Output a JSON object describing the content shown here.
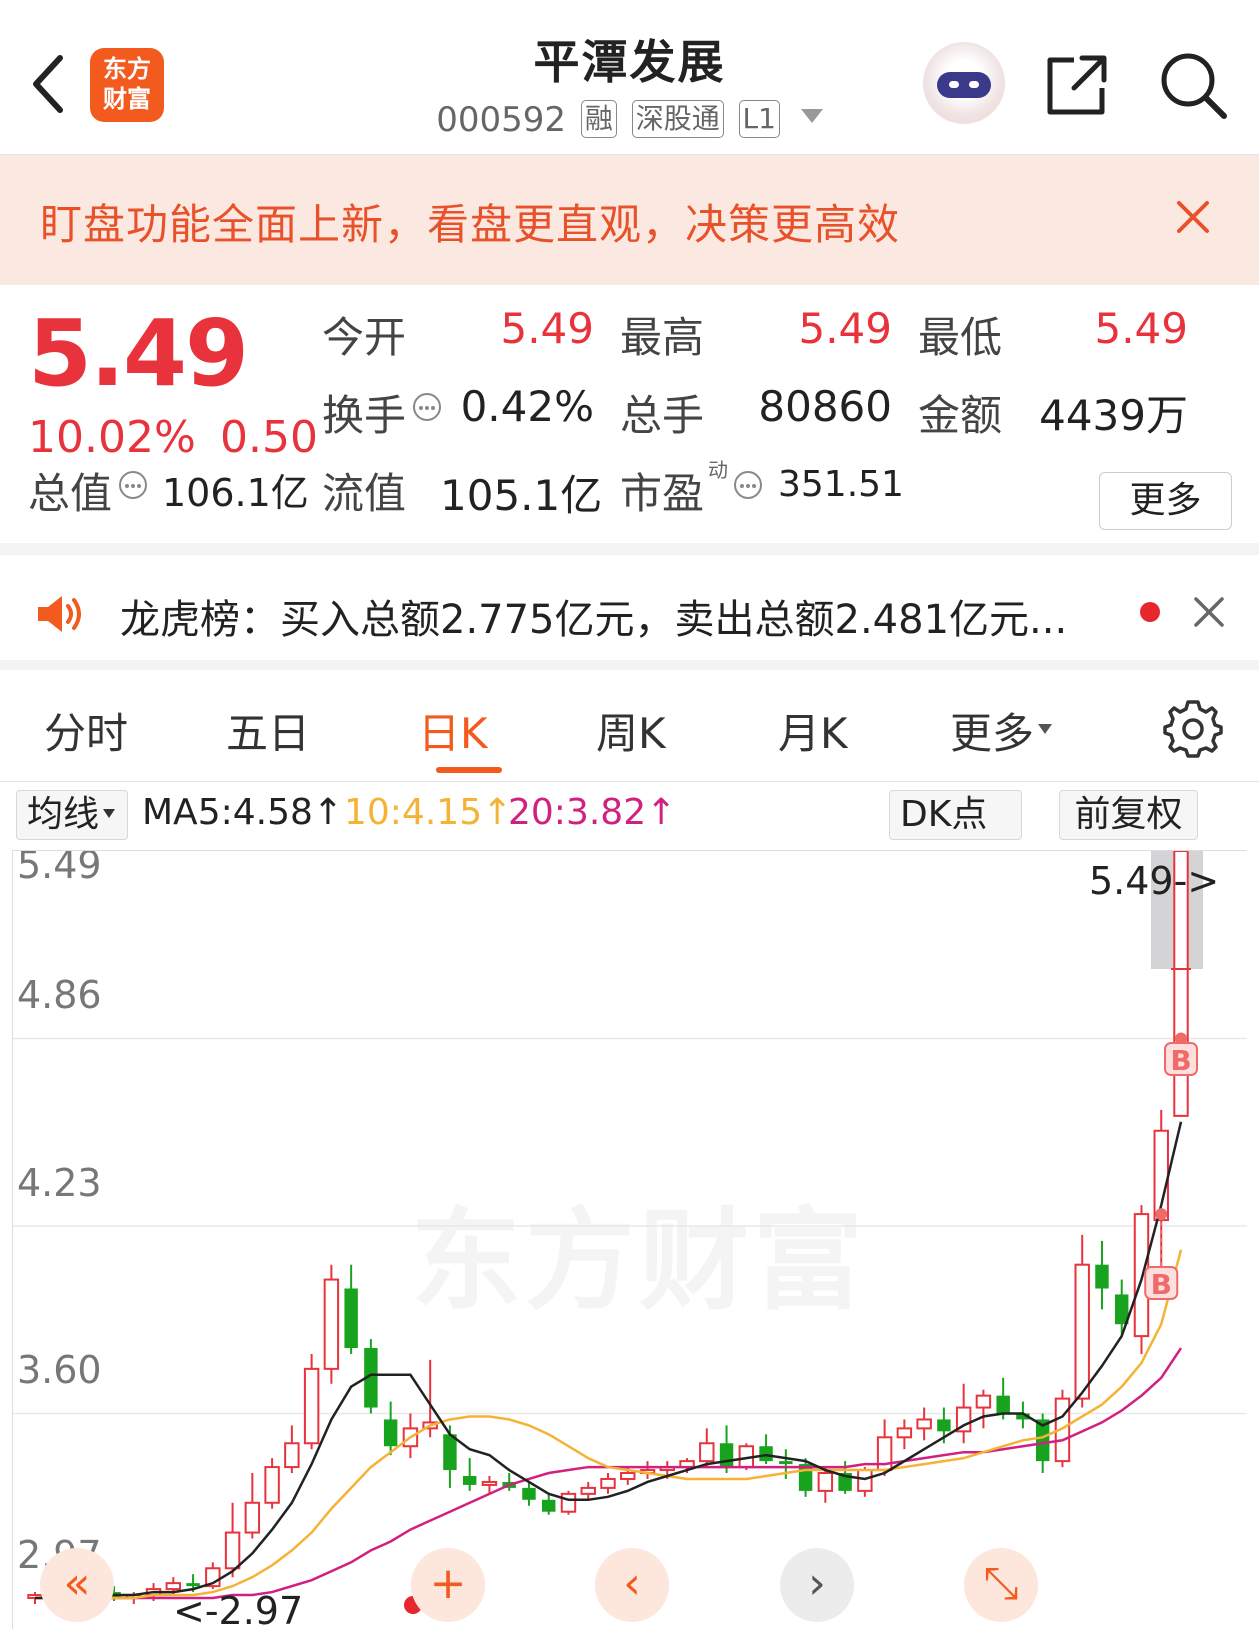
{
  "header": {
    "title": "平潭发展",
    "code": "000592",
    "tags": [
      "融",
      "深股通",
      "L1"
    ],
    "logo_lines": [
      "东方",
      "财富"
    ]
  },
  "banner": {
    "text": "盯盘功能全面上新，看盘更直观，决策更高效"
  },
  "quote": {
    "price": "5.49",
    "change_pct": "10.02%",
    "change": "0.50",
    "open_label": "今开",
    "open": "5.49",
    "high_label": "最高",
    "high": "5.49",
    "low_label": "最低",
    "low": "5.49",
    "turnover_label": "换手",
    "turnover": "0.42%",
    "volume_label": "总手",
    "volume": "80860",
    "amount_label": "金额",
    "amount": "4439万",
    "mcap_label": "总值",
    "mcap": "106.1亿",
    "float_label": "流值",
    "float": "105.1亿",
    "pe_label": "市盈",
    "pe_sup": "动",
    "pe": "351.51",
    "more_label": "更多"
  },
  "news": {
    "text": "龙虎榜：买入总额2.775亿元，卖出总额2.481亿元..."
  },
  "tabs": {
    "items": [
      "分时",
      "五日",
      "日K",
      "周K",
      "月K",
      "更多"
    ],
    "active": "日K"
  },
  "ma_bar": {
    "indicator_label": "均线",
    "ma5": "MA5:4.58↑",
    "ma10": "10:4.15↑",
    "ma20": "20:3.82↑",
    "dk_label": "DK点",
    "adjust_label": "前复权",
    "colors": {
      "ma5": "#222222",
      "ma10": "#f5b335",
      "ma20": "#d1207f"
    }
  },
  "chart_data": {
    "type": "candlestick",
    "y_ticks": [
      "5.49",
      "4.86",
      "4.23",
      "3.60",
      "2.97"
    ],
    "ylim": [
      2.97,
      5.49
    ],
    "last_price_label": "5.49->",
    "low_label": "<-2.97",
    "watermark": "东方财富",
    "up_color": "#e8323c",
    "down_color": "#17a31e",
    "signal_label": "B",
    "candles": [
      [
        2.98,
        3.0,
        2.96,
        2.99
      ],
      [
        2.99,
        3.01,
        2.97,
        2.98
      ],
      [
        2.98,
        3.0,
        2.96,
        2.97
      ],
      [
        2.97,
        3.02,
        2.96,
        3.0
      ],
      [
        3.0,
        3.02,
        2.97,
        2.98
      ],
      [
        2.98,
        3.0,
        2.96,
        2.99
      ],
      [
        2.99,
        3.03,
        2.97,
        3.01
      ],
      [
        3.01,
        3.05,
        2.99,
        3.03
      ],
      [
        3.03,
        3.06,
        3.0,
        3.02
      ],
      [
        3.02,
        3.1,
        3.01,
        3.08
      ],
      [
        3.08,
        3.3,
        3.05,
        3.2
      ],
      [
        3.2,
        3.4,
        3.18,
        3.3
      ],
      [
        3.3,
        3.45,
        3.28,
        3.42
      ],
      [
        3.42,
        3.56,
        3.4,
        3.5
      ],
      [
        3.5,
        3.8,
        3.48,
        3.75
      ],
      [
        3.75,
        4.1,
        3.7,
        4.05
      ],
      [
        4.02,
        4.1,
        3.8,
        3.82
      ],
      [
        3.82,
        3.85,
        3.6,
        3.62
      ],
      [
        3.58,
        3.64,
        3.46,
        3.49
      ],
      [
        3.49,
        3.6,
        3.45,
        3.55
      ],
      [
        3.55,
        3.78,
        3.52,
        3.57
      ],
      [
        3.53,
        3.56,
        3.35,
        3.41
      ],
      [
        3.39,
        3.45,
        3.34,
        3.36
      ],
      [
        3.36,
        3.39,
        3.33,
        3.37
      ],
      [
        3.37,
        3.4,
        3.34,
        3.35
      ],
      [
        3.35,
        3.37,
        3.29,
        3.31
      ],
      [
        3.31,
        3.33,
        3.26,
        3.27
      ],
      [
        3.27,
        3.34,
        3.26,
        3.33
      ],
      [
        3.33,
        3.37,
        3.31,
        3.35
      ],
      [
        3.35,
        3.4,
        3.33,
        3.38
      ],
      [
        3.38,
        3.42,
        3.36,
        3.4
      ],
      [
        3.4,
        3.44,
        3.38,
        3.41
      ],
      [
        3.41,
        3.44,
        3.38,
        3.42
      ],
      [
        3.42,
        3.45,
        3.4,
        3.44
      ],
      [
        3.44,
        3.55,
        3.42,
        3.5
      ],
      [
        3.5,
        3.56,
        3.4,
        3.42
      ],
      [
        3.42,
        3.5,
        3.41,
        3.49
      ],
      [
        3.49,
        3.53,
        3.43,
        3.44
      ],
      [
        3.44,
        3.48,
        3.38,
        3.43
      ],
      [
        3.43,
        3.45,
        3.32,
        3.34
      ],
      [
        3.34,
        3.42,
        3.3,
        3.4
      ],
      [
        3.4,
        3.44,
        3.33,
        3.34
      ],
      [
        3.34,
        3.42,
        3.32,
        3.41
      ],
      [
        3.41,
        3.58,
        3.39,
        3.52
      ],
      [
        3.52,
        3.58,
        3.48,
        3.55
      ],
      [
        3.55,
        3.62,
        3.51,
        3.58
      ],
      [
        3.58,
        3.62,
        3.5,
        3.54
      ],
      [
        3.54,
        3.7,
        3.5,
        3.62
      ],
      [
        3.62,
        3.68,
        3.55,
        3.66
      ],
      [
        3.66,
        3.72,
        3.58,
        3.6
      ],
      [
        3.6,
        3.64,
        3.55,
        3.58
      ],
      [
        3.58,
        3.6,
        3.4,
        3.44
      ],
      [
        3.44,
        3.68,
        3.42,
        3.65
      ],
      [
        3.65,
        4.2,
        3.62,
        4.1
      ],
      [
        4.1,
        4.18,
        3.95,
        4.02
      ],
      [
        4.0,
        4.05,
        3.86,
        3.9
      ],
      [
        3.86,
        4.3,
        3.8,
        4.27
      ],
      [
        4.25,
        4.62,
        4.0,
        4.55
      ],
      [
        4.6,
        5.49,
        4.86,
        5.49
      ]
    ],
    "ma5": [
      2.98,
      2.98,
      2.98,
      2.99,
      2.99,
      2.99,
      3.0,
      3.0,
      3.01,
      3.03,
      3.07,
      3.13,
      3.21,
      3.3,
      3.43,
      3.58,
      3.69,
      3.73,
      3.73,
      3.73,
      3.63,
      3.53,
      3.48,
      3.46,
      3.41,
      3.37,
      3.33,
      3.31,
      3.31,
      3.32,
      3.34,
      3.37,
      3.39,
      3.41,
      3.43,
      3.44,
      3.45,
      3.46,
      3.45,
      3.44,
      3.41,
      3.39,
      3.38,
      3.4,
      3.44,
      3.48,
      3.52,
      3.56,
      3.59,
      3.6,
      3.6,
      3.56,
      3.59,
      3.67,
      3.76,
      3.86,
      4.05,
      4.3,
      4.58
    ],
    "ma10": [
      2.98,
      2.98,
      2.98,
      2.98,
      2.98,
      2.98,
      2.99,
      2.99,
      2.99,
      3.0,
      3.02,
      3.05,
      3.09,
      3.14,
      3.2,
      3.28,
      3.35,
      3.42,
      3.47,
      3.52,
      3.56,
      3.58,
      3.59,
      3.59,
      3.58,
      3.56,
      3.53,
      3.49,
      3.45,
      3.42,
      3.41,
      3.4,
      3.39,
      3.38,
      3.38,
      3.38,
      3.38,
      3.39,
      3.4,
      3.41,
      3.41,
      3.41,
      3.41,
      3.41,
      3.42,
      3.43,
      3.44,
      3.45,
      3.47,
      3.49,
      3.51,
      3.52,
      3.55,
      3.59,
      3.63,
      3.69,
      3.77,
      3.9,
      4.15
    ],
    "ma20": [
      2.98,
      2.98,
      2.98,
      2.98,
      2.98,
      2.98,
      2.98,
      2.98,
      2.98,
      2.98,
      2.99,
      2.99,
      3.0,
      3.02,
      3.04,
      3.07,
      3.1,
      3.14,
      3.17,
      3.21,
      3.24,
      3.27,
      3.3,
      3.33,
      3.36,
      3.38,
      3.4,
      3.41,
      3.42,
      3.42,
      3.42,
      3.42,
      3.42,
      3.42,
      3.42,
      3.42,
      3.42,
      3.42,
      3.42,
      3.42,
      3.42,
      3.42,
      3.43,
      3.43,
      3.44,
      3.45,
      3.46,
      3.47,
      3.47,
      3.48,
      3.49,
      3.5,
      3.51,
      3.54,
      3.57,
      3.61,
      3.66,
      3.72,
      3.82
    ]
  },
  "nav": {
    "rewind": "«",
    "zoom_in": "+",
    "prev": "‹",
    "next": "›",
    "fullscreen": "⤡"
  }
}
